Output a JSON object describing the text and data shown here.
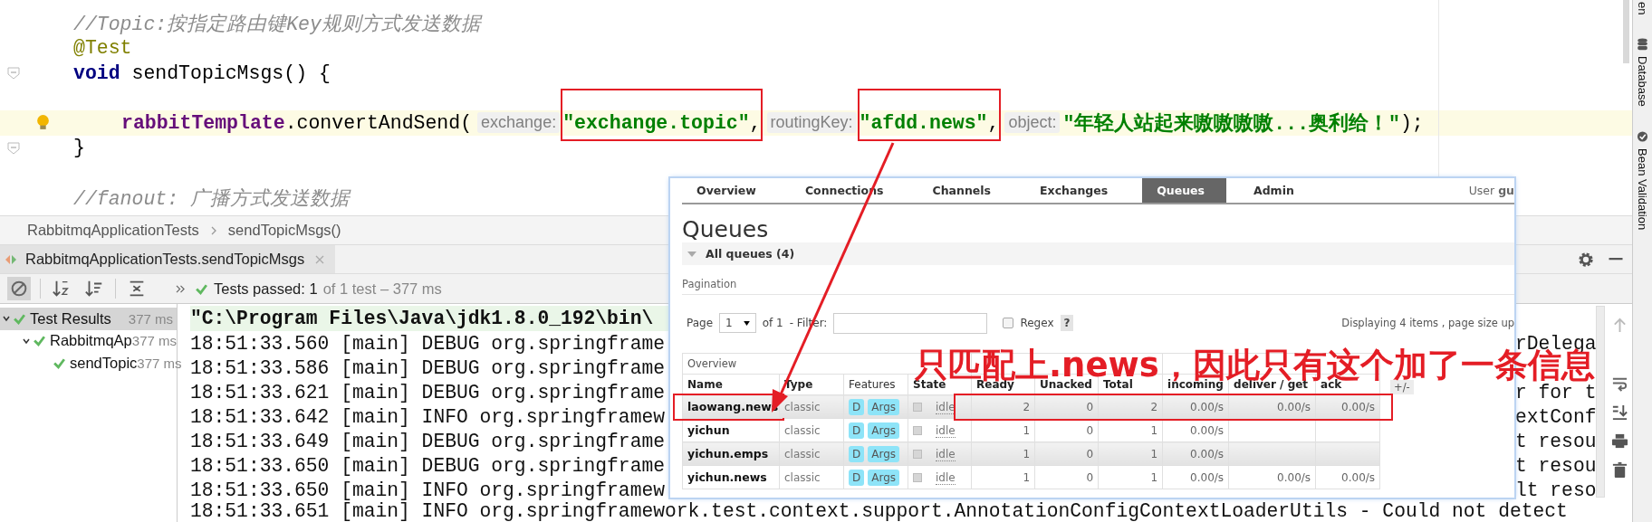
{
  "editor": {
    "lines": [
      {
        "kind": "comment",
        "text": "//Topic:按指定路由键Key规则方式发送数据"
      },
      {
        "kind": "annotation",
        "text": "@Test"
      },
      {
        "kind": "declaration",
        "keyword": "void",
        "text": "sendTopicMsgs() {",
        "fold": true
      },
      {
        "kind": "blank"
      },
      {
        "kind": "statement",
        "current": true,
        "bulb": true,
        "tokens": [
          {
            "kind": "field",
            "text": "rabbitTemplate"
          },
          {
            "kind": "plain",
            "text": ".convertAndSend("
          },
          {
            "kind": "hint",
            "text": "exchange:"
          },
          {
            "kind": "string",
            "text": "\"exchange.topic\"",
            "boxed": true
          },
          {
            "kind": "plain",
            "text": ","
          },
          {
            "kind": "hint",
            "text": "routingKey:"
          },
          {
            "kind": "string",
            "text": "\"afdd.news\"",
            "boxed": true
          },
          {
            "kind": "plain",
            "text": ","
          },
          {
            "kind": "hint",
            "text": "object:"
          },
          {
            "kind": "string",
            "text": "\"年轻人站起来嗷嗷嗷嗷...奥利给！\"",
            "boxed": false
          },
          {
            "kind": "plain",
            "text": ");"
          }
        ]
      },
      {
        "kind": "close",
        "text": "}",
        "fold": true
      },
      {
        "kind": "blank"
      },
      {
        "kind": "comment",
        "text": "//fanout: 广播方式发送数据"
      }
    ]
  },
  "side_stripe": [
    {
      "kind": "cut",
      "label": "en"
    },
    {
      "kind": "database",
      "label": "Database"
    },
    {
      "kind": "bean",
      "label": "Bean Validation"
    }
  ],
  "breadcrumbs": [
    "RabbitmqApplicationTests",
    "sendTopicMsgs()"
  ],
  "run_tab": {
    "title": "RabbitmqApplicationTests.sendTopicMsgs",
    "selected": true
  },
  "toolbar": {
    "status": "Tests passed: 1",
    "detail": "of 1 test – 377 ms"
  },
  "test_tree": [
    {
      "label": "Test Results",
      "time": "377 ms",
      "selected": true,
      "children": [
        {
          "label": "RabbitmqAp",
          "time": "377 ms",
          "selected": false,
          "children": [
            {
              "label": "sendTopic",
              "time": "377 ms",
              "selected": false
            }
          ]
        }
      ]
    }
  ],
  "console": {
    "command": "\"C:\\Program Files\\Java\\jdk1.8.0_192\\bin\\",
    "lines": [
      {
        "left": "18:51:33.560 [main] DEBUG org.springframe",
        "right": "rDelega"
      },
      {
        "left": "18:51:33.586 [main] DEBUG org.springframe"
      },
      {
        "left": "18:51:33.621 [main] DEBUG org.springframe",
        "right": "r for t"
      },
      {
        "left": "18:51:33.642 [main] INFO org.springframew",
        "right": "extConf"
      },
      {
        "left": "18:51:33.649 [main] DEBUG org.springframe",
        "right": "t resou"
      },
      {
        "left": "18:51:33.650 [main] DEBUG org.springframe",
        "right": "t resou"
      },
      {
        "left": "18:51:33.650 [main] INFO org.springframew",
        "right": "lt reso"
      }
    ],
    "last_line": "18:51:33.651 [main] INFO org.springframework.test.context.support.AnnotationConfigContextLoaderUtils - Could not detect"
  },
  "browser": {
    "tabs": [
      {
        "label": "Overview",
        "selected": false
      },
      {
        "label": "Connections",
        "selected": false
      },
      {
        "label": "Channels",
        "selected": false
      },
      {
        "label": "Exchanges",
        "selected": false
      },
      {
        "label": "Queues",
        "selected": true
      },
      {
        "label": "Admin",
        "selected": false
      }
    ],
    "user": "User **gu**",
    "heading": "Queues",
    "section": "All queues (4)",
    "pagination_label": "Pagination",
    "page_label": "Page",
    "page_value": "1",
    "of": "of 1",
    "filter_label": "- Filter:",
    "regex_label": "Regex",
    "regex_checked": false,
    "help": "?",
    "displaying": "Displaying 4 items , page size up",
    "groups": [
      {
        "label": "Overview"
      }
    ],
    "toggle": "+/-",
    "columns": [
      "Name",
      "Type",
      "Features",
      "State",
      "Ready",
      "Unacked",
      "Total",
      "incoming",
      "deliver / get",
      "ack"
    ],
    "rows": [
      {
        "name": "laowang.news",
        "type": "classic",
        "features": [
          "D",
          "Args"
        ],
        "state": "idle",
        "ready": "2",
        "unacked": "0",
        "total": "2",
        "incoming": "0.00/s",
        "deliver_get": "0.00/s",
        "ack": "0.00/s",
        "highlighted": true
      },
      {
        "name": "yichun",
        "type": "classic",
        "features": [
          "D",
          "Args"
        ],
        "state": "idle",
        "ready": "1",
        "unacked": "0",
        "total": "1",
        "incoming": "0.00/s",
        "highlighted": false
      },
      {
        "name": "yichun.emps",
        "type": "classic",
        "features": [
          "D",
          "Args"
        ],
        "state": "idle",
        "ready": "1",
        "unacked": "0",
        "total": "1",
        "incoming": "0.00/s",
        "highlighted": false
      },
      {
        "name": "yichun.news",
        "type": "classic",
        "features": [
          "D",
          "Args"
        ],
        "state": "idle",
        "ready": "1",
        "unacked": "0",
        "total": "1",
        "incoming": "0.00/s",
        "deliver_get": "0.00/s",
        "ack": "0.00/s",
        "highlighted": false
      }
    ]
  },
  "annotation": "只匹配上.news，因此只有这个加了一条信息"
}
